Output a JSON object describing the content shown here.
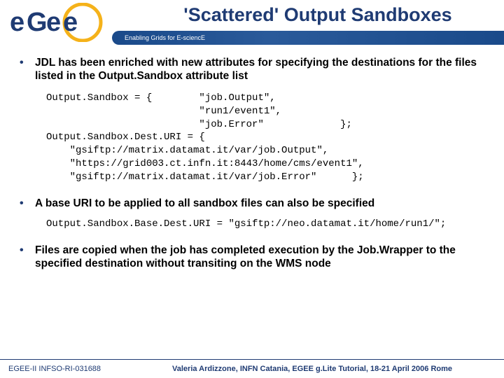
{
  "header": {
    "title": "'Scattered' Output Sandboxes",
    "subtitle": "Enabling Grids for E-sciencE",
    "logo_text_e": "e",
    "logo_text_g": "G",
    "logo_text_ee": "ee"
  },
  "bullets": [
    "JDL has been enriched with new attributes for specifying the destinations for the files listed in the Output.Sandbox attribute list",
    "A base URI to be applied to all sandbox files can also be specified",
    "Files are copied when the job has completed execution by the Job.Wrapper to the specified destination without transiting on the WMS node"
  ],
  "code1": "Output.Sandbox = {        \"job.Output\",\n                          \"run1/event1\",\n                          \"job.Error\"             };\nOutput.Sandbox.Dest.URI = {\n    \"gsiftp://matrix.datamat.it/var/job.Output\",\n    \"https://grid003.ct.infn.it:8443/home/cms/event1\",\n    \"gsiftp://matrix.datamat.it/var/job.Error\"      };",
  "code2": "Output.Sandbox.Base.Dest.URI = \"gsiftp://neo.datamat.it/home/run1/\";",
  "footer": {
    "left": "EGEE-II INFSO-RI-031688",
    "right": "Valeria Ardizzone, INFN Catania, EGEE g.Lite Tutorial, 18-21 April 2006 Rome"
  }
}
